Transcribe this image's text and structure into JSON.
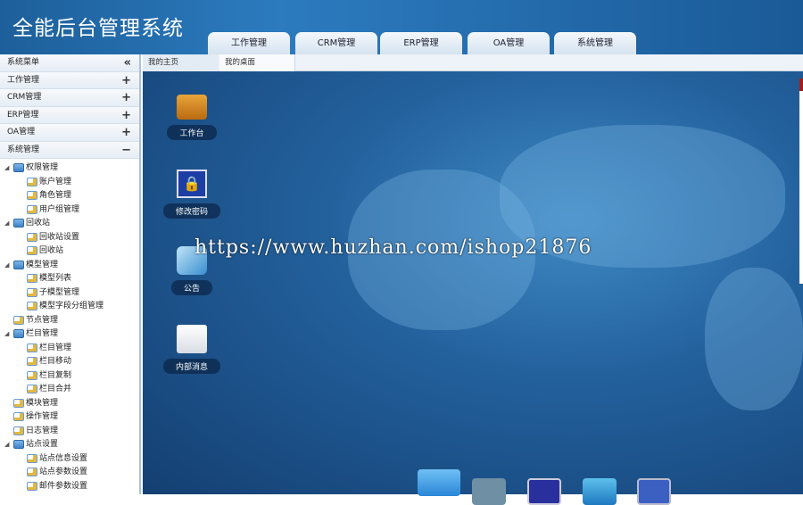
{
  "app_title": "全能后台管理系统",
  "top_tabs": [
    "工作管理",
    "CRM管理",
    "ERP管理",
    "OA管理",
    "系统管理"
  ],
  "sidebar": {
    "header": "系统菜单",
    "collapse_icon": "«",
    "sections": [
      {
        "label": "工作管理",
        "sign": "+"
      },
      {
        "label": "CRM管理",
        "sign": "+"
      },
      {
        "label": "ERP管理",
        "sign": "+"
      },
      {
        "label": "OA管理",
        "sign": "+"
      },
      {
        "label": "系统管理",
        "sign": "−"
      }
    ],
    "tree": [
      {
        "label": "权限管理",
        "level": 0,
        "type": "folder"
      },
      {
        "label": "账户管理",
        "level": 1,
        "type": "file"
      },
      {
        "label": "角色管理",
        "level": 1,
        "type": "file"
      },
      {
        "label": "用户组管理",
        "level": 1,
        "type": "file"
      },
      {
        "label": "回收站",
        "level": 0,
        "type": "folder"
      },
      {
        "label": "回收站设置",
        "level": 1,
        "type": "file"
      },
      {
        "label": "回收站",
        "level": 1,
        "type": "file"
      },
      {
        "label": "模型管理",
        "level": 0,
        "type": "folder"
      },
      {
        "label": "模型列表",
        "level": 1,
        "type": "file"
      },
      {
        "label": "子模型管理",
        "level": 1,
        "type": "file"
      },
      {
        "label": "模型字段分组管理",
        "level": 1,
        "type": "file"
      },
      {
        "label": "节点管理",
        "level": 0,
        "type": "file"
      },
      {
        "label": "栏目管理",
        "level": 0,
        "type": "folder"
      },
      {
        "label": "栏目管理",
        "level": 1,
        "type": "file"
      },
      {
        "label": "栏目移动",
        "level": 1,
        "type": "file"
      },
      {
        "label": "栏目复制",
        "level": 1,
        "type": "file"
      },
      {
        "label": "栏目合并",
        "level": 1,
        "type": "file"
      },
      {
        "label": "模块管理",
        "level": 0,
        "type": "file"
      },
      {
        "label": "操作管理",
        "level": 0,
        "type": "file"
      },
      {
        "label": "日志管理",
        "level": 0,
        "type": "file"
      },
      {
        "label": "站点设置",
        "level": 0,
        "type": "folder"
      },
      {
        "label": "站点信息设置",
        "level": 1,
        "type": "file"
      },
      {
        "label": "站点参数设置",
        "level": 1,
        "type": "file"
      },
      {
        "label": "邮件参数设置",
        "level": 1,
        "type": "file"
      }
    ]
  },
  "page_tabs": [
    "我的主页",
    "我的桌面"
  ],
  "desktop_icons": [
    {
      "label": "工作台",
      "icon": "folder-icon"
    },
    {
      "label": "修改密码",
      "icon": "lock-icon"
    },
    {
      "label": "公告",
      "icon": "announcement-icon"
    },
    {
      "label": "内部消息",
      "icon": "mail-icon"
    }
  ],
  "watermark": "https://www.huzhan.com/ishop21876",
  "dock": [
    "home-icon",
    "calendar-icon",
    "user-icon",
    "refresh-icon",
    "tools-icon"
  ]
}
